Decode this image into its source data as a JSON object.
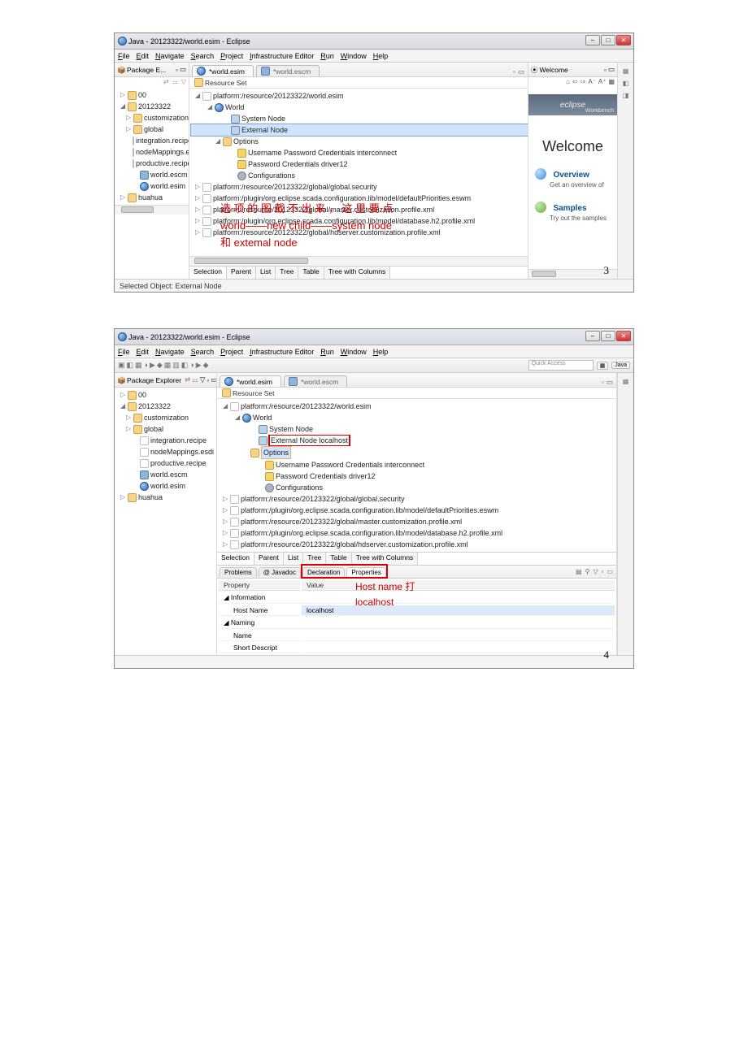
{
  "s1": {
    "title": "Java - 20123322/world.esim - Eclipse",
    "menus": [
      "File",
      "Edit",
      "Navigate",
      "Search",
      "Project",
      "Infrastructure Editor",
      "Run",
      "Window",
      "Help"
    ],
    "pkg_header": "Package E...",
    "pkg_tree": [
      {
        "ind": "ind5",
        "tw": "▷",
        "ic": "ic-folder",
        "txt": "00"
      },
      {
        "ind": "ind5",
        "tw": "◢",
        "ic": "ic-folder-open",
        "txt": "20123322"
      },
      {
        "ind": "ind12",
        "tw": "▷",
        "ic": "ic-folder",
        "txt": "customization"
      },
      {
        "ind": "ind12",
        "tw": "▷",
        "ic": "ic-folder",
        "txt": "global"
      },
      {
        "ind": "ind20",
        "tw": "",
        "ic": "ic-file",
        "txt": "integration.recipe"
      },
      {
        "ind": "ind20",
        "tw": "",
        "ic": "ic-file",
        "txt": "nodeMappings.e"
      },
      {
        "ind": "ind20",
        "tw": "",
        "ic": "ic-file",
        "txt": "productive.recipe"
      },
      {
        "ind": "ind20",
        "tw": "",
        "ic": "ic-cube",
        "txt": "world.escm"
      },
      {
        "ind": "ind20",
        "tw": "",
        "ic": "ic-globe",
        "txt": "world.esim"
      },
      {
        "ind": "ind5",
        "tw": "▷",
        "ic": "ic-folder",
        "txt": "huahua"
      }
    ],
    "editor_tabs": [
      "*world.esim",
      "*world.escm"
    ],
    "editor_sub": "Resource Set",
    "editor_tree": [
      {
        "ind": "ind5",
        "tw": "◢",
        "ic": "ic-file",
        "txt": "platform:/resource/20123322/world.esim"
      },
      {
        "ind": "ind20",
        "tw": "◢",
        "ic": "ic-globe",
        "txt": "World"
      },
      {
        "ind": "ind40",
        "tw": "",
        "ic": "ic-monitor",
        "txt": "System Node"
      },
      {
        "ind": "ind40",
        "tw": "",
        "ic": "ic-monitor",
        "txt": "External Node",
        "sel": true
      },
      {
        "ind": "ind30",
        "tw": "◢",
        "ic": "ic-folder",
        "txt": "Options"
      },
      {
        "ind": "ind48",
        "tw": "",
        "ic": "ic-key",
        "txt": "Username Password Credentials interconnect"
      },
      {
        "ind": "ind48",
        "tw": "",
        "ic": "ic-key",
        "txt": "Password Credentials driver12"
      },
      {
        "ind": "ind48",
        "tw": "",
        "ic": "ic-gear",
        "txt": "Configurations"
      },
      {
        "ind": "ind5",
        "tw": "▷",
        "ic": "ic-file",
        "txt": "platform:/resource/20123322/global/global.security"
      },
      {
        "ind": "ind5",
        "tw": "▷",
        "ic": "ic-file",
        "txt": "platform:/plugin/org.eclipse.scada.configuration.lib/model/defaultPriorities.eswm"
      },
      {
        "ind": "ind5",
        "tw": "▷",
        "ic": "ic-file",
        "txt": "platform:/resource/20123322/global/master.customization.profile.xml"
      },
      {
        "ind": "ind5",
        "tw": "▷",
        "ic": "ic-file",
        "txt": "platform:/plugin/org.eclipse.scada.configuration.lib/model/database.h2.profile.xml"
      },
      {
        "ind": "ind5",
        "tw": "▷",
        "ic": "ic-file",
        "txt": "platform:/resource/20123322/global/hdserver.customization.profile.xml"
      }
    ],
    "bottom_tabs": [
      "Selection",
      "Parent",
      "List",
      "Tree",
      "Table",
      "Tree with Columns"
    ],
    "welcome_tab": "Welcome",
    "workbench": "Workbench",
    "welcome": "Welcome",
    "overview_t": "Overview",
    "overview_d": "Get an overview of",
    "samples_t": "Samples",
    "samples_d": "Try out the samples",
    "status": "Selected Object: External Node",
    "page": "3",
    "anno1": "选 项 的 图 截 不 出 来 ， 这 里 要 点",
    "anno2": "world——new child——system node",
    "anno3": "和 extemal node"
  },
  "s2": {
    "title": "Java - 20123322/world.esim - Eclipse",
    "menus": [
      "File",
      "Edit",
      "Navigate",
      "Search",
      "Project",
      "Infrastructure Editor",
      "Run",
      "Window",
      "Help"
    ],
    "quick": "Quick Access",
    "persp": "Java",
    "pkg_header": "Package Explorer",
    "pkg_tree": [
      {
        "ind": "ind5",
        "tw": "▷",
        "ic": "ic-folder",
        "txt": "00"
      },
      {
        "ind": "ind5",
        "tw": "◢",
        "ic": "ic-folder-open",
        "txt": "20123322"
      },
      {
        "ind": "ind12",
        "tw": "▷",
        "ic": "ic-folder",
        "txt": "customization"
      },
      {
        "ind": "ind12",
        "tw": "▷",
        "ic": "ic-folder",
        "txt": "global"
      },
      {
        "ind": "ind20",
        "tw": "",
        "ic": "ic-file",
        "txt": "integration.recipe"
      },
      {
        "ind": "ind20",
        "tw": "",
        "ic": "ic-file",
        "txt": "nodeMappings.esdi"
      },
      {
        "ind": "ind20",
        "tw": "",
        "ic": "ic-file",
        "txt": "productive.recipe"
      },
      {
        "ind": "ind20",
        "tw": "",
        "ic": "ic-cube",
        "txt": "world.escm"
      },
      {
        "ind": "ind20",
        "tw": "",
        "ic": "ic-globe",
        "txt": "world.esim"
      },
      {
        "ind": "ind5",
        "tw": "▷",
        "ic": "ic-folder",
        "txt": "huahua"
      }
    ],
    "editor_tabs": [
      "*world.esim",
      "*world.escm"
    ],
    "editor_sub": "Resource Set",
    "editor_tree": [
      {
        "ind": "ind5",
        "tw": "◢",
        "ic": "ic-file",
        "txt": "platform:/resource/20123322/world.esim"
      },
      {
        "ind": "ind20",
        "tw": "◢",
        "ic": "ic-globe",
        "txt": "World"
      },
      {
        "ind": "ind40",
        "tw": "",
        "ic": "ic-monitor",
        "txt": "System Node"
      },
      {
        "ind": "ind40",
        "tw": "",
        "ic": "ic-monitor",
        "txt": "External Node localhost",
        "red": true
      },
      {
        "ind": "ind30",
        "tw": "",
        "ic": "ic-folder",
        "txt": "Options",
        "opt": true
      },
      {
        "ind": "ind48",
        "tw": "",
        "ic": "ic-key",
        "txt": "Username Password Credentials interconnect"
      },
      {
        "ind": "ind48",
        "tw": "",
        "ic": "ic-key",
        "txt": "Password Credentials driver12"
      },
      {
        "ind": "ind48",
        "tw": "",
        "ic": "ic-gear",
        "txt": "Configurations"
      },
      {
        "ind": "ind5",
        "tw": "▷",
        "ic": "ic-file",
        "txt": "platform:/resource/20123322/global/global.security"
      },
      {
        "ind": "ind5",
        "tw": "▷",
        "ic": "ic-file",
        "txt": "platform:/plugin/org.eclipse.scada.configuration.lib/model/defaultPriorities.eswm"
      },
      {
        "ind": "ind5",
        "tw": "▷",
        "ic": "ic-file",
        "txt": "platform:/resource/20123322/global/master.customization.profile.xml"
      },
      {
        "ind": "ind5",
        "tw": "▷",
        "ic": "ic-file",
        "txt": "platform:/plugin/org.eclipse.scada.configuration.lib/model/database.h2.profile.xml"
      },
      {
        "ind": "ind5",
        "tw": "▷",
        "ic": "ic-file",
        "txt": "platform:/resource/20123322/global/hdserver.customization.profile.xml"
      }
    ],
    "bottom_tabs": [
      "Selection",
      "Parent",
      "List",
      "Tree",
      "Table",
      "Tree with Columns"
    ],
    "pp_tabs": [
      "Problems",
      "Javadoc",
      "Declaration",
      "Properties"
    ],
    "prop_header": [
      "Property",
      "Value"
    ],
    "prop_sections": [
      {
        "name": "Information",
        "rows": [
          [
            "Host Name",
            "localhost"
          ]
        ]
      },
      {
        "name": "Naming",
        "rows": [
          [
            "Name",
            ""
          ],
          [
            "Short Descript",
            ""
          ]
        ]
      }
    ],
    "anno1": "Host   name   打",
    "anno2": "localhost",
    "page": "4"
  }
}
